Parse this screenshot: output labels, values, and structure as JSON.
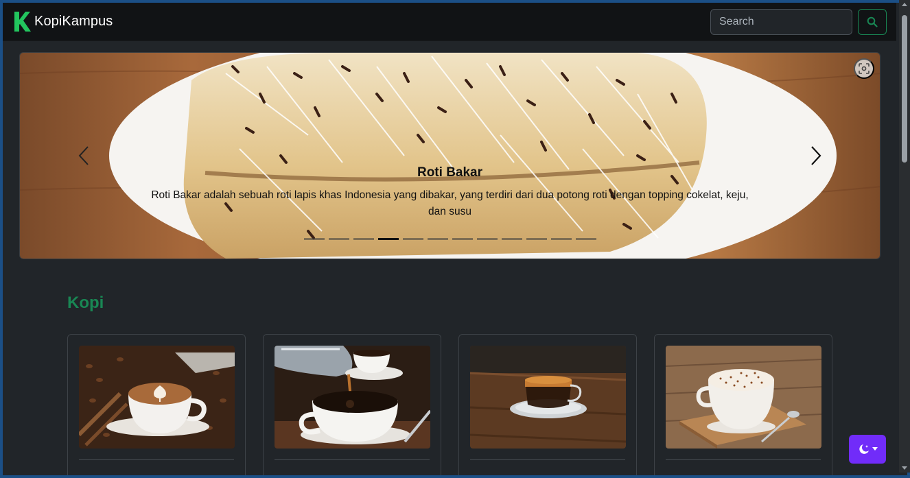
{
  "navbar": {
    "brand": "KopiKampus",
    "logo_icon": "k-logo-icon",
    "search_placeholder": "Search",
    "search_icon": "search-icon"
  },
  "colors": {
    "accent": "#198754",
    "theme_button": "#712cf9",
    "background": "#212529",
    "navbar": "#111315"
  },
  "carousel": {
    "title": "Roti Bakar",
    "text": "Roti Bakar adalah sebuah roti lapis khas Indonesia yang dibakar, yang terdiri dari dua potong roti dengan topping cokelat, keju, dan susu",
    "slide_count": 12,
    "active_index": 3,
    "prev_icon": "chevron-left-icon",
    "next_icon": "chevron-right-icon",
    "lens_icon": "visual-search-icon"
  },
  "section": {
    "title": "Kopi"
  },
  "cards": [
    {
      "image": "latte-art-image"
    },
    {
      "image": "pouring-coffee-image"
    },
    {
      "image": "espresso-image"
    },
    {
      "image": "cappuccino-image"
    }
  ],
  "theme_toggle": {
    "icon": "moon-stars-icon"
  }
}
